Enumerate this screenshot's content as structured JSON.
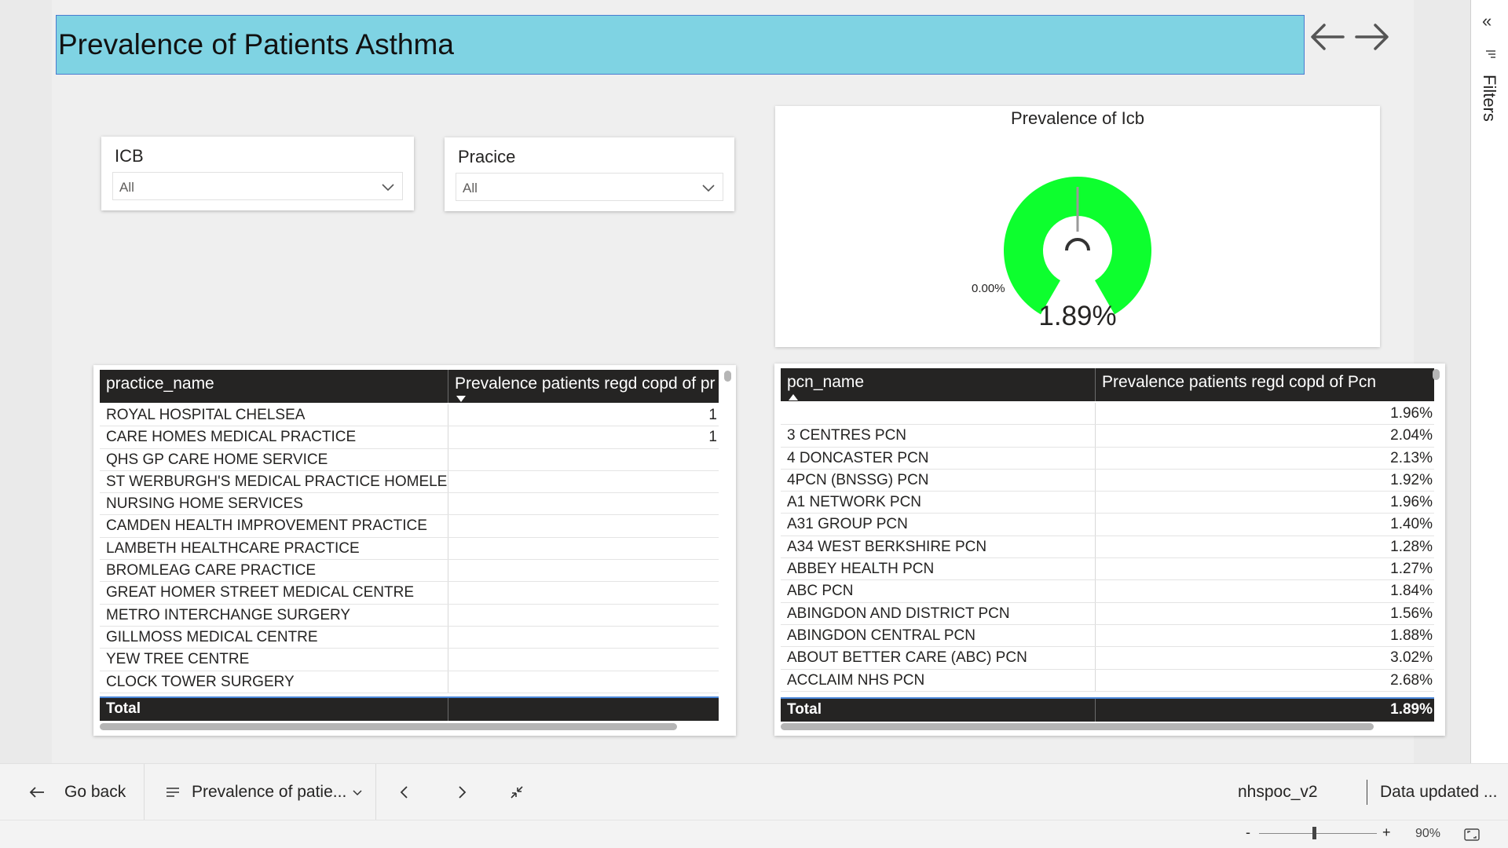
{
  "report": {
    "title": "Prevalence of Patients Asthma"
  },
  "nav": {
    "back_icon": "arrow-left-icon",
    "forward_icon": "arrow-right-icon"
  },
  "slicers": {
    "icb": {
      "label": "ICB",
      "value": "All"
    },
    "practice": {
      "label": "Pracice",
      "value": "All"
    }
  },
  "gauge": {
    "title": "Prevalence of Icb",
    "min_label": "0.00%",
    "value_label": "1.89%",
    "fill_fraction": 0.5,
    "color": "#0dff2e"
  },
  "practice_table": {
    "headers": [
      "practice_name",
      "Prevalence patients regd copd of pr"
    ],
    "rows": [
      [
        "ROYAL HOSPITAL CHELSEA",
        "1"
      ],
      [
        "CARE HOMES MEDICAL PRACTICE",
        "1"
      ],
      [
        "QHS GP CARE HOME SERVICE",
        ""
      ],
      [
        "ST WERBURGH'S MEDICAL PRACTICE HOMELESS",
        ""
      ],
      [
        "NURSING HOME SERVICES",
        ""
      ],
      [
        "CAMDEN HEALTH IMPROVEMENT PRACTICE",
        ""
      ],
      [
        "LAMBETH HEALTHCARE PRACTICE",
        ""
      ],
      [
        "BROMLEAG CARE PRACTICE",
        ""
      ],
      [
        "GREAT HOMER STREET MEDICAL CENTRE",
        ""
      ],
      [
        "METRO INTERCHANGE SURGERY",
        ""
      ],
      [
        "GILLMOSS MEDICAL CENTRE",
        ""
      ],
      [
        "YEW TREE CENTRE",
        ""
      ],
      [
        "CLOCK TOWER SURGERY",
        ""
      ]
    ],
    "total": [
      "Total",
      ""
    ]
  },
  "pcn_table": {
    "headers": [
      "pcn_name",
      "Prevalence patients regd copd of Pcn"
    ],
    "rows": [
      [
        "",
        "1.96%"
      ],
      [
        "3 CENTRES PCN",
        "2.04%"
      ],
      [
        "4 DONCASTER PCN",
        "2.13%"
      ],
      [
        "4PCN (BNSSG) PCN",
        "1.92%"
      ],
      [
        "A1 NETWORK PCN",
        "1.96%"
      ],
      [
        "A31 GROUP PCN",
        "1.40%"
      ],
      [
        "A34 WEST BERKSHIRE PCN",
        "1.28%"
      ],
      [
        "ABBEY HEALTH PCN",
        "1.27%"
      ],
      [
        "ABC PCN",
        "1.84%"
      ],
      [
        "ABINGDON AND DISTRICT PCN",
        "1.56%"
      ],
      [
        "ABINGDON CENTRAL PCN",
        "1.88%"
      ],
      [
        "ABOUT BETTER CARE (ABC) PCN",
        "3.02%"
      ],
      [
        "ACCLAIM NHS PCN",
        "2.68%"
      ]
    ],
    "total": [
      "Total",
      "1.89%"
    ]
  },
  "filters_pane": {
    "label": "Filters",
    "collapse_glyph": "«"
  },
  "bottom_bar": {
    "go_back": "Go back",
    "page_name": "Prevalence of patie...",
    "workspace": "nhspoc_v2",
    "data_updated": "Data updated ..."
  },
  "status_bar": {
    "zoom_minus": "-",
    "zoom_plus": "+",
    "zoom_level": "90%",
    "zoom_fraction": 0.45
  }
}
